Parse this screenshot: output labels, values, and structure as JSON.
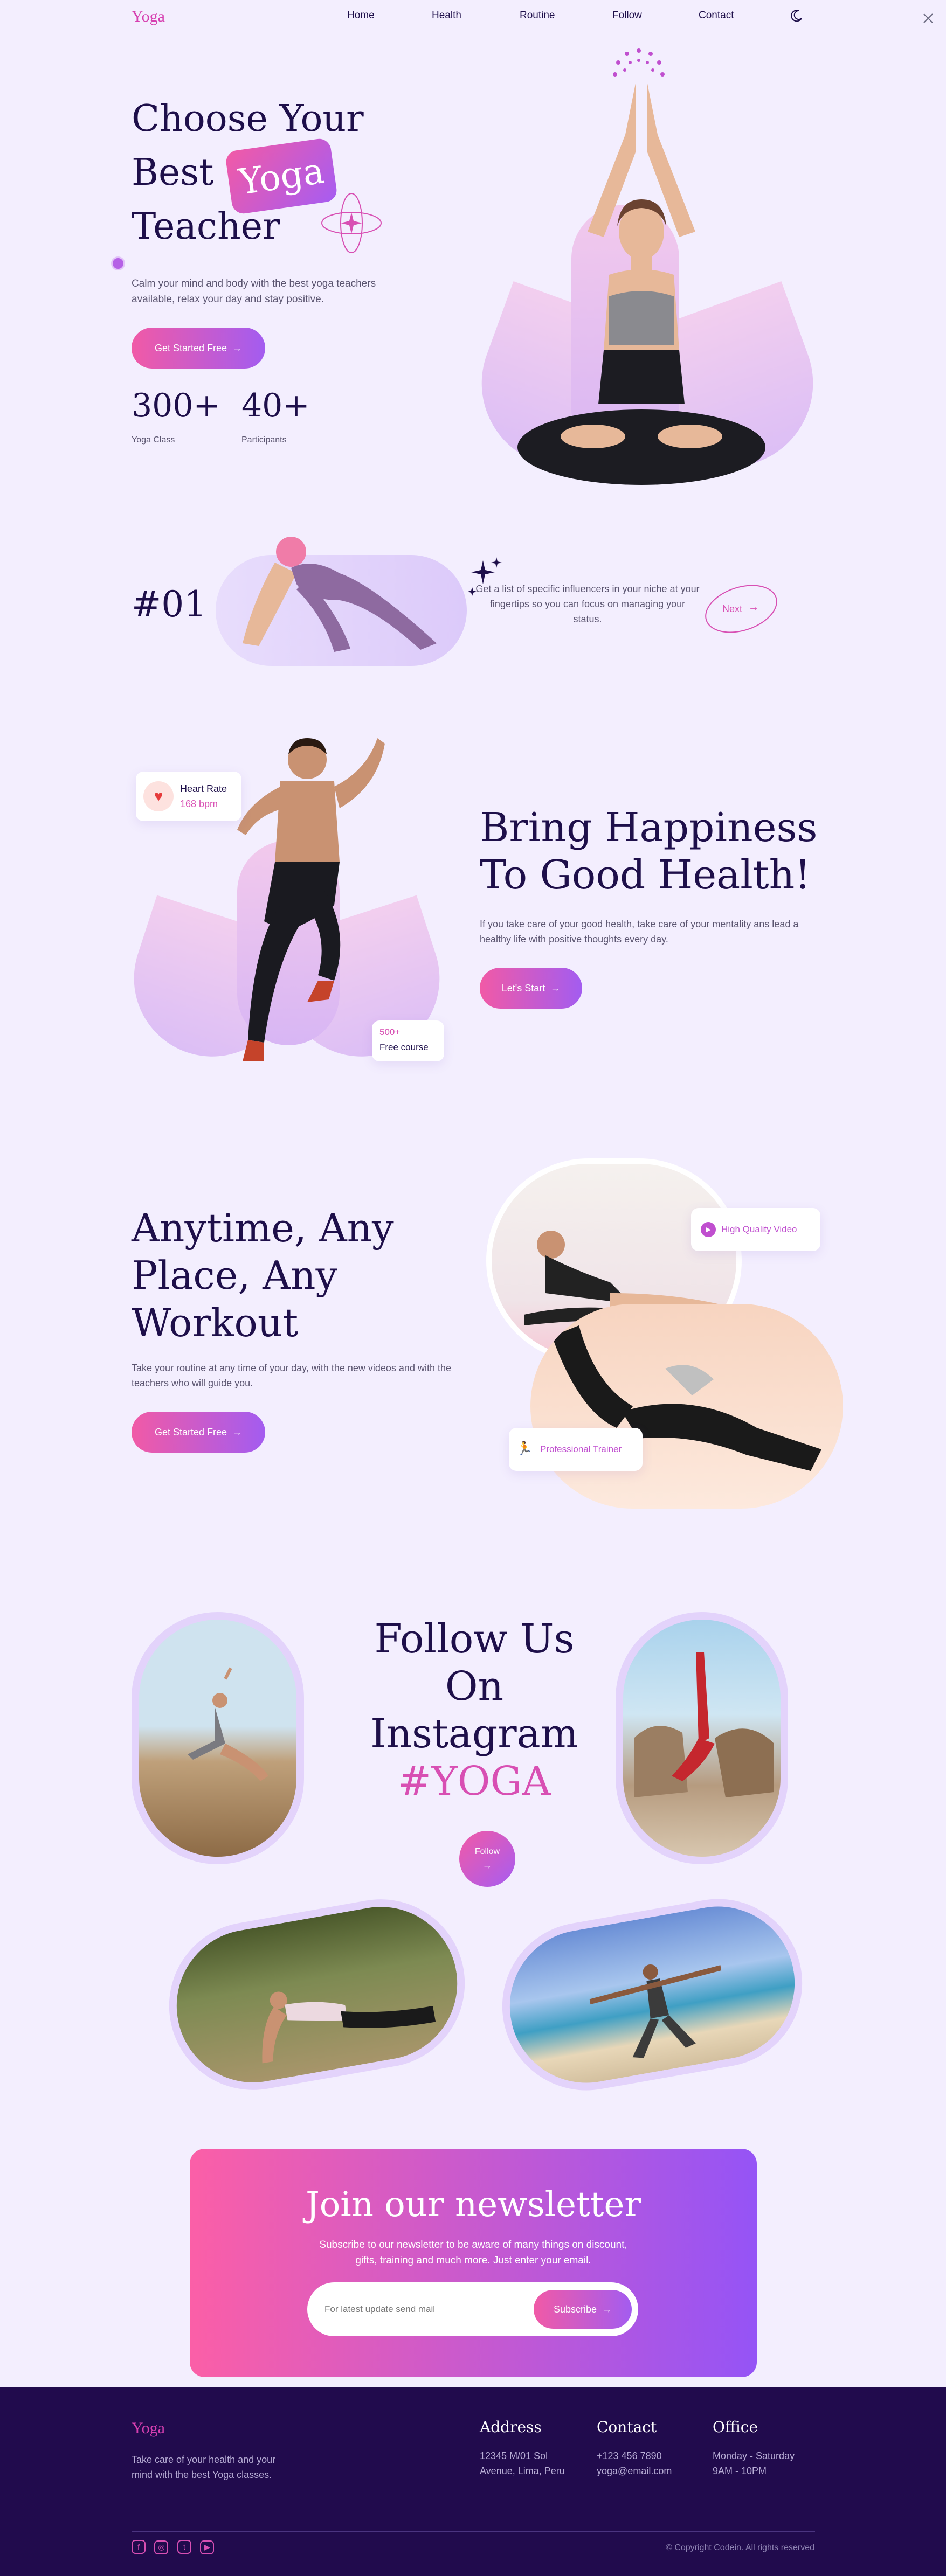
{
  "nav": {
    "logo": "Yoga",
    "items": [
      "Home",
      "Health",
      "Routine",
      "Follow",
      "Contact"
    ],
    "theme_icon": "moon-icon",
    "close_icon": "close-icon"
  },
  "hero": {
    "title_line1": "Choose Your",
    "title_best": "Best",
    "title_badge": "Yoga",
    "title_line3": "Teacher",
    "description": "Calm your mind and body with the best yoga teachers available, relax your day and stay positive.",
    "cta": "Get Started Free",
    "stats": [
      {
        "value": "300+",
        "label": "Yoga Class"
      },
      {
        "value": "40+",
        "label": "Participants"
      }
    ]
  },
  "influencer": {
    "number": "#01",
    "text": "Get a list of specific influencers in your niche at your fingertips so you can focus on managing your status.",
    "next": "Next"
  },
  "happiness": {
    "heart_title": "Heart Rate",
    "heart_value": "168 bpm",
    "course_count": "500+",
    "course_label": "Free course",
    "title_line1": "Bring Happiness",
    "title_line2": "To Good Health!",
    "description": "If you take care of your good health, take care of your mentality ans lead a healthy life with positive thoughts every day.",
    "cta": "Let's Start"
  },
  "workout": {
    "title_line1": "Anytime, Any",
    "title_line2": "Place, Any",
    "title_line3": "Workout",
    "description": "Take your routine at any time of your day, with the new videos and with the teachers who will guide you.",
    "cta": "Get Started Free",
    "badge_video": "High Quality Video",
    "badge_trainer": "Professional Trainer"
  },
  "instagram": {
    "title_line1": "Follow Us",
    "title_line2": "On",
    "title_line3": "Instagram",
    "hashtag": "#YOGA",
    "follow": "Follow"
  },
  "newsletter": {
    "title": "Join our newsletter",
    "description": "Subscribe to our newsletter to be aware of many things on discount, gifts, training and much more. Just enter your email.",
    "placeholder": "For latest update send mail",
    "button": "Subscribe"
  },
  "footer": {
    "logo": "Yoga",
    "about": "Take care of your health and your mind with the best Yoga classes.",
    "address_title": "Address",
    "address_line1": "12345 M/01 Sol",
    "address_line2": "Avenue, Lima, Peru",
    "contact_title": "Contact",
    "contact_phone": "+123 456 7890",
    "contact_email": "yoga@email.com",
    "office_title": "Office",
    "office_days": "Monday - Saturday",
    "office_hours": "9AM - 10PM",
    "social_icons": [
      "facebook-icon",
      "instagram-icon",
      "twitter-icon",
      "youtube-icon"
    ],
    "copyright": "© Copyright Codein. All rights reserved"
  },
  "colors": {
    "background": "#f3eefe",
    "primary_text": "#1e0f4a",
    "accent_pink": "#d63fb0",
    "gradient_start": "#f15aa6",
    "gradient_end": "#a35cf0",
    "footer_bg": "#210b4d"
  }
}
